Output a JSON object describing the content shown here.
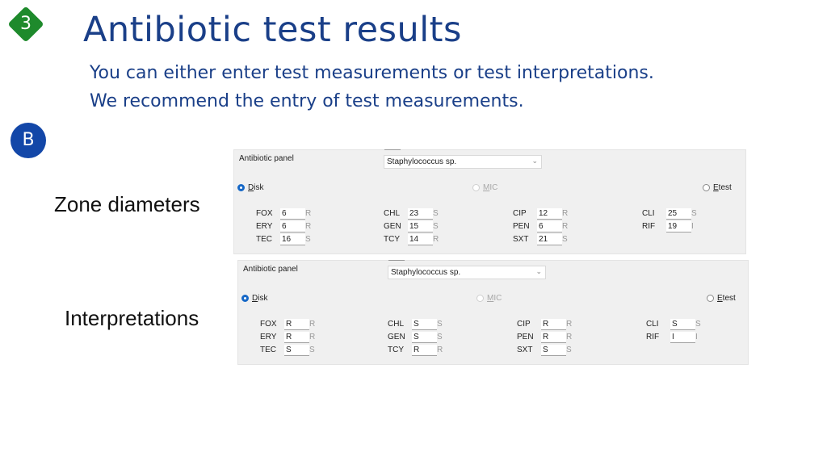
{
  "step_badge": "3",
  "section_badge": "B",
  "title": "Antibiotic test results",
  "subtitle_line1": "You can either enter test measurements or test interpretations.",
  "subtitle_line2": "We recommend the entry of test measurements.",
  "labels": {
    "zone": "Zone diameters",
    "interp": "Interpretations"
  },
  "panels": [
    {
      "panel_label": "Antibiotic panel",
      "organism": "Staphylococcus sp.",
      "radios": {
        "disk": "Disk",
        "mic": "MIC",
        "etest": "Etest",
        "selected": "disk"
      },
      "rows": [
        {
          "code": "FOX",
          "value": "6",
          "interp": "R"
        },
        {
          "code": "ERY",
          "value": "6",
          "interp": "R"
        },
        {
          "code": "TEC",
          "value": "16",
          "interp": "S"
        },
        {
          "code": "CHL",
          "value": "23",
          "interp": "S"
        },
        {
          "code": "GEN",
          "value": "15",
          "interp": "S"
        },
        {
          "code": "TCY",
          "value": "14",
          "interp": "R"
        },
        {
          "code": "CIP",
          "value": "12",
          "interp": "R"
        },
        {
          "code": "PEN",
          "value": "6",
          "interp": "R"
        },
        {
          "code": "SXT",
          "value": "21",
          "interp": "S"
        },
        {
          "code": "CLI",
          "value": "25",
          "interp": "S"
        },
        {
          "code": "RIF",
          "value": "19",
          "interp": "I"
        }
      ]
    },
    {
      "panel_label": "Antibiotic panel",
      "organism": "Staphylococcus sp.",
      "radios": {
        "disk": "Disk",
        "mic": "MIC",
        "etest": "Etest",
        "selected": "disk"
      },
      "rows": [
        {
          "code": "FOX",
          "value": "R",
          "interp": "R"
        },
        {
          "code": "ERY",
          "value": "R",
          "interp": "R"
        },
        {
          "code": "TEC",
          "value": "S",
          "interp": "S"
        },
        {
          "code": "CHL",
          "value": "S",
          "interp": "S"
        },
        {
          "code": "GEN",
          "value": "S",
          "interp": "S"
        },
        {
          "code": "TCY",
          "value": "R",
          "interp": "R"
        },
        {
          "code": "CIP",
          "value": "R",
          "interp": "R"
        },
        {
          "code": "PEN",
          "value": "R",
          "interp": "R"
        },
        {
          "code": "SXT",
          "value": "S",
          "interp": "S"
        },
        {
          "code": "CLI",
          "value": "S",
          "interp": "S"
        },
        {
          "code": "RIF",
          "value": "I",
          "interp": "I"
        }
      ]
    }
  ],
  "colors": {
    "title": "#1a3f88",
    "step_badge": "#1e8a2c",
    "section_badge": "#1347a8",
    "radio_selected": "#1668c7"
  }
}
